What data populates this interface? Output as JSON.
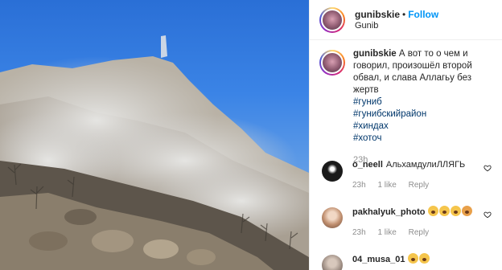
{
  "post": {
    "username": "gunibskie",
    "separator": "•",
    "follow_label": "Follow",
    "location": "Gunib"
  },
  "caption": {
    "username": "gunibskie",
    "text": "А вот то о чем и говорил, произошёл второй обвал, и слава Аллагьу без жертв",
    "hashtags": [
      "#гуниб",
      "#гунибскийрайон",
      "#хиндах",
      "#хоточ"
    ],
    "time": "23h"
  },
  "comments": [
    {
      "username": "o_neell",
      "text": "АльхамдулиЛЛЯГЬ",
      "time": "23h",
      "likes": "1 like",
      "reply": "Reply",
      "avatar_color": "#1a1a1a"
    },
    {
      "username": "pakhalyuk_photo",
      "text": "",
      "emoji_count": 4,
      "time": "23h",
      "likes": "1 like",
      "reply": "Reply",
      "avatar_color": "#caa48a"
    },
    {
      "username": "04_musa_01",
      "text": "",
      "emoji_count": 2,
      "avatar_color": "#9a8a80"
    }
  ],
  "colors": {
    "follow": "#0095f6",
    "hashtag": "#00376b",
    "meta": "#8e8e8e"
  }
}
